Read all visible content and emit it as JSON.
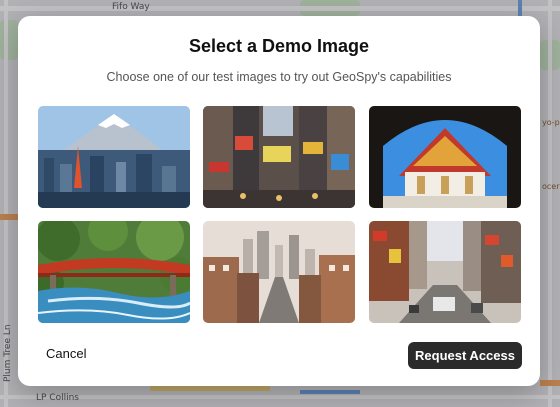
{
  "map": {
    "street_labels": [
      "Fifo Way",
      "Plum Tree Ln",
      "LP Collins"
    ],
    "poi_labels": [
      "yo-p",
      "ocery"
    ],
    "colors": {
      "road": "#ffffff",
      "highway": "#f6d77a",
      "arterial": "#f4a35c",
      "water_route": "#6fa6e8",
      "park": "#cde8c7"
    }
  },
  "modal": {
    "title": "Select a Demo Image",
    "subtitle": "Choose one of our test images to try out GeoSpy's capabilities",
    "images": [
      {
        "name": "mount-fuji-tokyo-thumbnail",
        "subject": "mountain-city"
      },
      {
        "name": "times-square-thumbnail",
        "subject": "times-square"
      },
      {
        "name": "thai-temple-thumbnail",
        "subject": "temple"
      },
      {
        "name": "red-bridge-river-thumbnail",
        "subject": "bridge-river"
      },
      {
        "name": "city-skyline-street-thumbnail",
        "subject": "skyline"
      },
      {
        "name": "chinatown-street-thumbnail",
        "subject": "street"
      }
    ],
    "cancel_label": "Cancel",
    "primary_label": "Request Access",
    "colors": {
      "primary_bg": "#2b2b2b",
      "primary_text": "#ffffff"
    }
  }
}
